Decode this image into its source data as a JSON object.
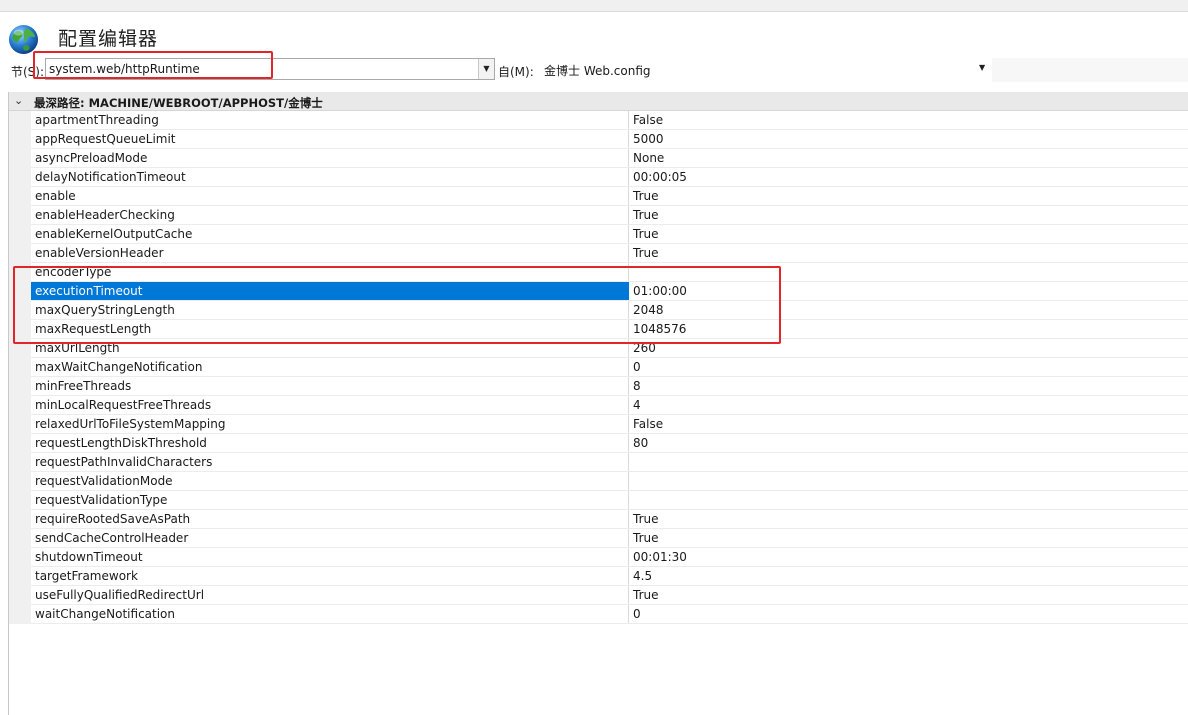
{
  "title": "配置编辑器",
  "section": {
    "label": "节(S):",
    "value": "system.web/httpRuntime"
  },
  "from": {
    "label": "自(M):",
    "value": "金博士 Web.config"
  },
  "grid": {
    "header_path": "最深路径: MACHINE/WEBROOT/APPHOST/金博士",
    "selected_index": 9,
    "rows": [
      {
        "name": "apartmentThreading",
        "value": "False"
      },
      {
        "name": "appRequestQueueLimit",
        "value": "5000"
      },
      {
        "name": "asyncPreloadMode",
        "value": "None"
      },
      {
        "name": "delayNotificationTimeout",
        "value": "00:00:05"
      },
      {
        "name": "enable",
        "value": "True"
      },
      {
        "name": "enableHeaderChecking",
        "value": "True"
      },
      {
        "name": "enableKernelOutputCache",
        "value": "True"
      },
      {
        "name": "enableVersionHeader",
        "value": "True"
      },
      {
        "name": "encoderType",
        "value": ""
      },
      {
        "name": "executionTimeout",
        "value": "01:00:00"
      },
      {
        "name": "maxQueryStringLength",
        "value": "2048"
      },
      {
        "name": "maxRequestLength",
        "value": "1048576"
      },
      {
        "name": "maxUrlLength",
        "value": "260"
      },
      {
        "name": "maxWaitChangeNotification",
        "value": "0"
      },
      {
        "name": "minFreeThreads",
        "value": "8"
      },
      {
        "name": "minLocalRequestFreeThreads",
        "value": "4"
      },
      {
        "name": "relaxedUrlToFileSystemMapping",
        "value": "False"
      },
      {
        "name": "requestLengthDiskThreshold",
        "value": "80"
      },
      {
        "name": "requestPathInvalidCharacters",
        "value": ""
      },
      {
        "name": "requestValidationMode",
        "value": ""
      },
      {
        "name": "requestValidationType",
        "value": ""
      },
      {
        "name": "requireRootedSaveAsPath",
        "value": "True"
      },
      {
        "name": "sendCacheControlHeader",
        "value": "True"
      },
      {
        "name": "shutdownTimeout",
        "value": "00:01:30"
      },
      {
        "name": "targetFramework",
        "value": "4.5"
      },
      {
        "name": "useFullyQualifiedRedirectUrl",
        "value": "True"
      },
      {
        "name": "waitChangeNotification",
        "value": "0"
      }
    ]
  },
  "colors": {
    "selection": "#0078d7",
    "highlight_box": "#e0262b"
  },
  "icons": {
    "app": "globe-icon",
    "section_dropdown": "chevron-down-icon",
    "group_toggle": "chevron-down-icon"
  }
}
